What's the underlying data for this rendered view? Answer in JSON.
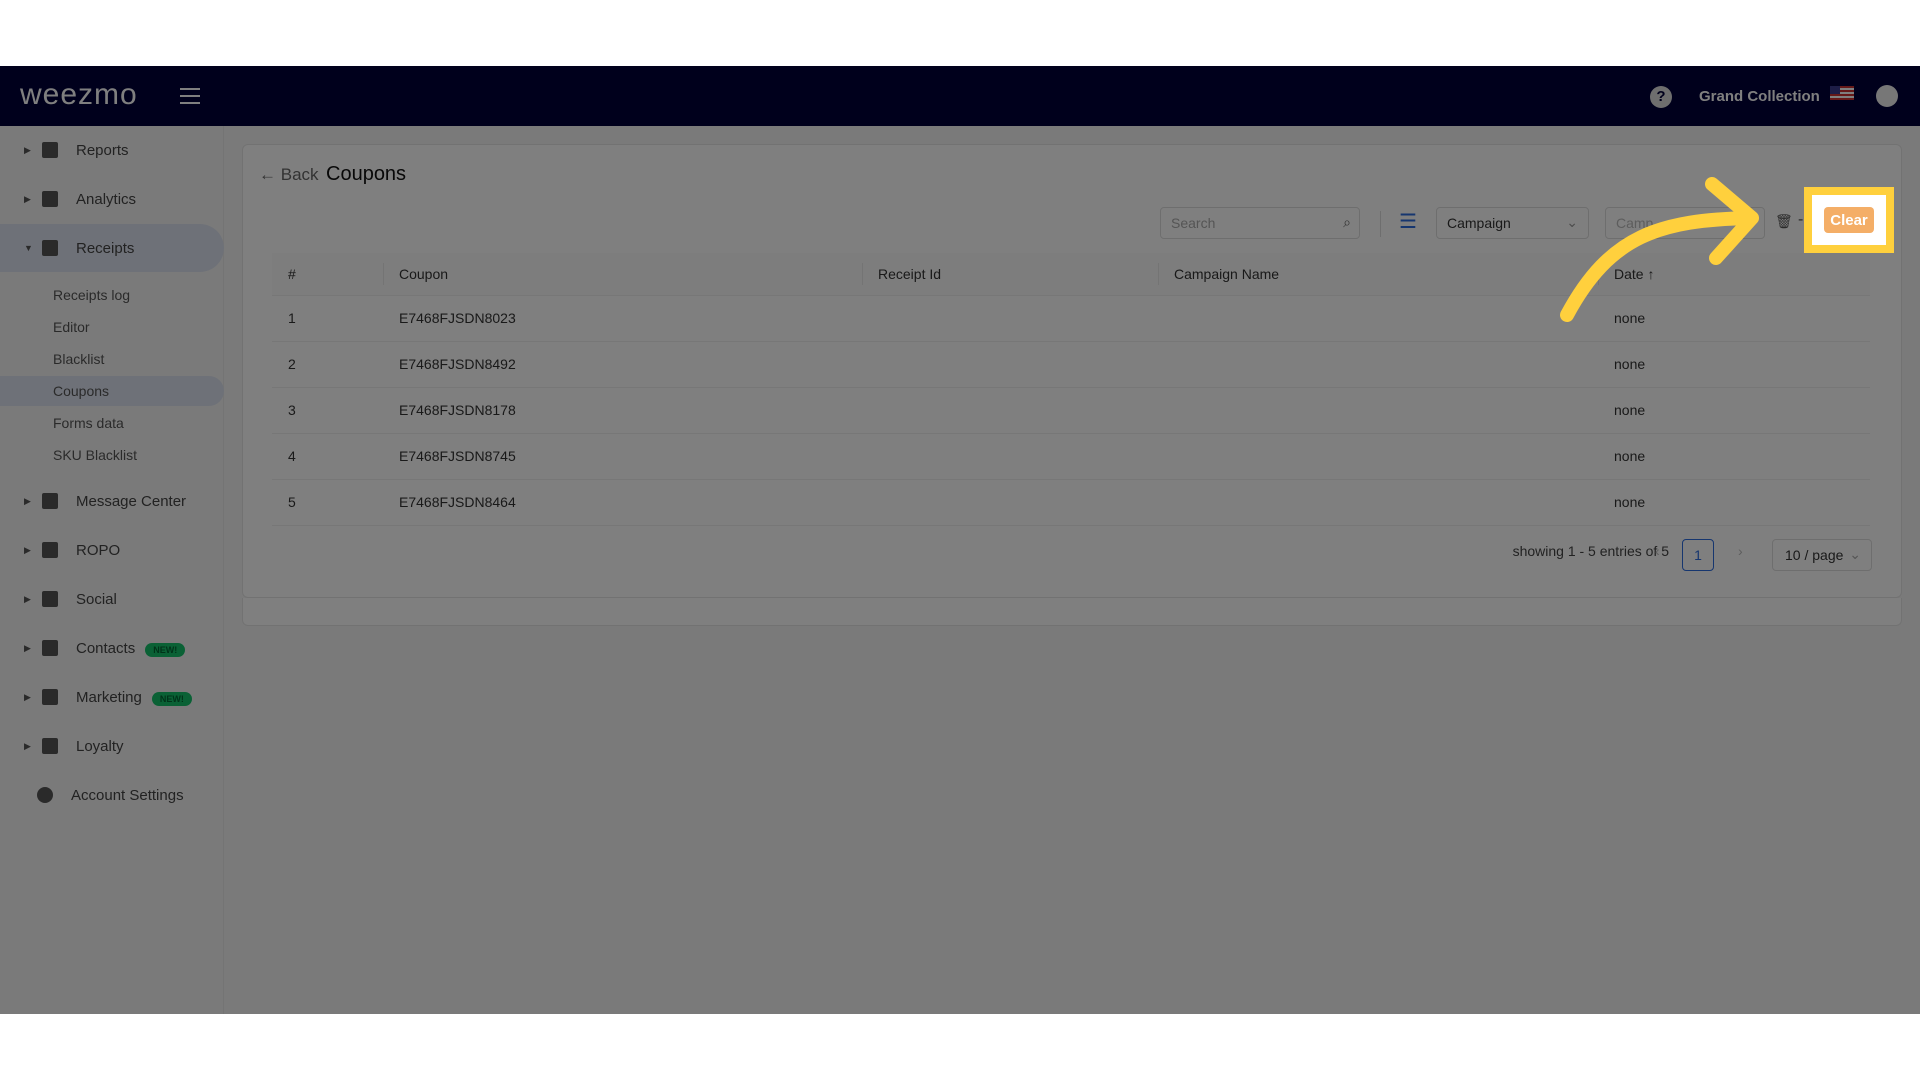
{
  "nav": {
    "logo": "weezmo",
    "org": "Grand Collection",
    "help": "?"
  },
  "sidebar": {
    "items": [
      {
        "label": "Reports",
        "icon": "dashboard-icon"
      },
      {
        "label": "Analytics",
        "icon": "chart-icon"
      },
      {
        "label": "Receipts",
        "icon": "receipt-icon",
        "open": true
      },
      {
        "label": "Message Center",
        "icon": "message-icon"
      },
      {
        "label": "ROPO",
        "icon": "infinity-icon"
      },
      {
        "label": "Social",
        "icon": "people-icon"
      },
      {
        "label": "Contacts",
        "icon": "contacts-icon",
        "badge": "NEW!"
      },
      {
        "label": "Marketing",
        "icon": "megaphone-icon",
        "badge": "NEW!"
      },
      {
        "label": "Loyalty",
        "icon": "tag-icon"
      },
      {
        "label": "Account Settings",
        "icon": "gear-icon"
      }
    ],
    "sub": [
      "Receipts log",
      "Editor",
      "Blacklist",
      "Coupons",
      "Forms data",
      "SKU Blacklist"
    ]
  },
  "page": {
    "back": "Back",
    "title": "Coupons"
  },
  "toolbar": {
    "search_placeholder": "Search",
    "campaign": "Campaign",
    "campaign2_placeholder": "Camp",
    "clear": "Clear"
  },
  "table": {
    "headers": [
      "#",
      "Coupon",
      "Receipt Id",
      "Campaign Name",
      "Date"
    ],
    "rows": [
      [
        "1",
        "E7468FJSDN8023",
        "",
        "",
        "none"
      ],
      [
        "2",
        "E7468FJSDN8492",
        "",
        "",
        "none"
      ],
      [
        "3",
        "E7468FJSDN8178",
        "",
        "",
        "none"
      ],
      [
        "4",
        "E7468FJSDN8745",
        "",
        "",
        "none"
      ],
      [
        "5",
        "E7468FJSDN8464",
        "",
        "",
        "none"
      ]
    ]
  },
  "pagination": {
    "summary": "showing 1 - 5 entries of 5",
    "page": "1",
    "per_page": "10 / page"
  },
  "colors": {
    "navbar": "#000038",
    "accent": "#2d6cdf",
    "clear": "#f4ae67",
    "highlight": "#ffd03d"
  }
}
